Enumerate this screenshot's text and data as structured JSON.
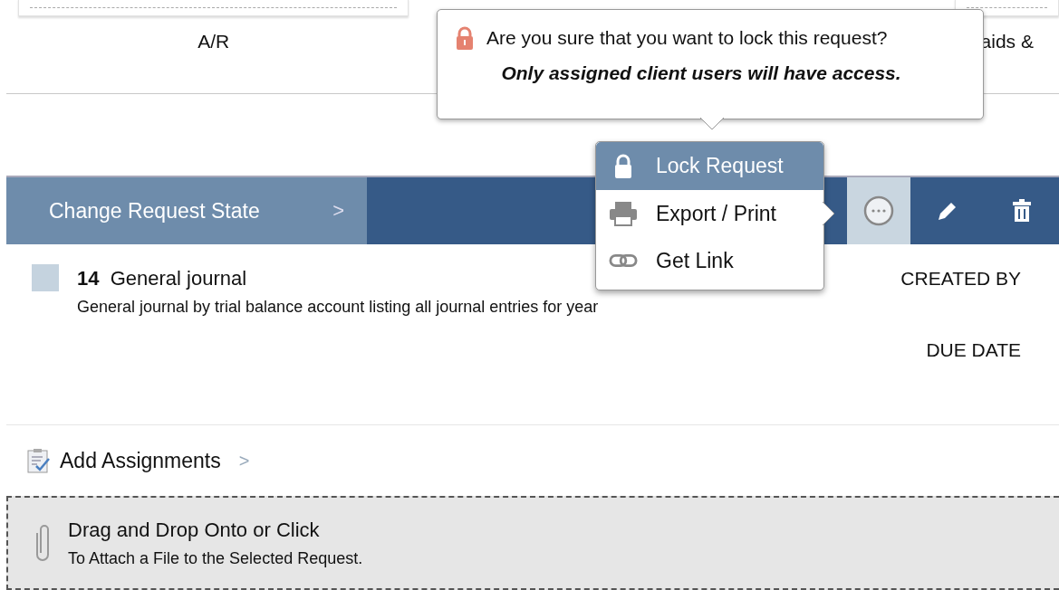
{
  "summary_cards": [
    {
      "label": "A/R"
    },
    {
      "label": "aids &"
    }
  ],
  "confirm_popup": {
    "question": "Are you sure that you want to lock this request?",
    "note": "Only assigned client users will have access."
  },
  "toolbar": {
    "state_button": "Change Request State",
    "chevron": ">",
    "more_active": true
  },
  "action_menu": [
    {
      "kind": "lock",
      "label": "Lock Request",
      "selected": true
    },
    {
      "kind": "print",
      "label": "Export / Print",
      "selected": false
    },
    {
      "kind": "link",
      "label": "Get Link",
      "selected": false
    }
  ],
  "request": {
    "number": "14",
    "title": "General journal",
    "description": "General journal by trial balance account listing all journal entries for year",
    "checked": false,
    "created_by_label": "CREATED BY",
    "due_date_label": "DUE DATE"
  },
  "assignments": {
    "label": "Add Assignments",
    "chevron": ">"
  },
  "drop_zone": {
    "title": "Drag and Drop Onto or Click",
    "subtitle": "To Attach a File to the Selected Request."
  }
}
